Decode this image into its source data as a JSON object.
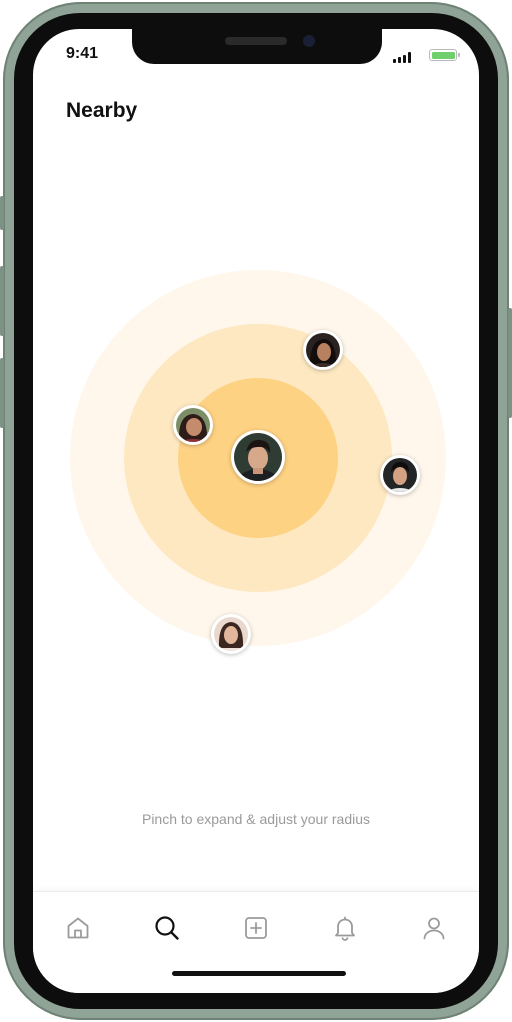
{
  "status_bar": {
    "time": "9:41",
    "signal_icon": "cellular-signal-icon",
    "battery_icon": "battery-icon",
    "battery_color": "#6fcf6c"
  },
  "header": {
    "title": "Nearby"
  },
  "radar": {
    "ring_colors": [
      "#fff7eb",
      "#fee8c2",
      "#fed283"
    ],
    "center_user": {
      "avatar": "man-portrait-avatar"
    },
    "nearby_users": [
      {
        "avatar": "woman-portrait-avatar"
      },
      {
        "avatar": "woman-portrait-avatar"
      },
      {
        "avatar": "man-portrait-avatar"
      },
      {
        "avatar": "woman-portrait-avatar"
      }
    ]
  },
  "hint": {
    "text": "Pinch to expand & adjust your radius"
  },
  "tab_bar": {
    "tabs": [
      {
        "icon": "home-icon",
        "active": false
      },
      {
        "icon": "search-icon",
        "active": true
      },
      {
        "icon": "add-square-icon",
        "active": false
      },
      {
        "icon": "bell-icon",
        "active": false
      },
      {
        "icon": "profile-icon",
        "active": false
      }
    ],
    "active_color": "#111111",
    "inactive_color": "#9b9b9b"
  }
}
